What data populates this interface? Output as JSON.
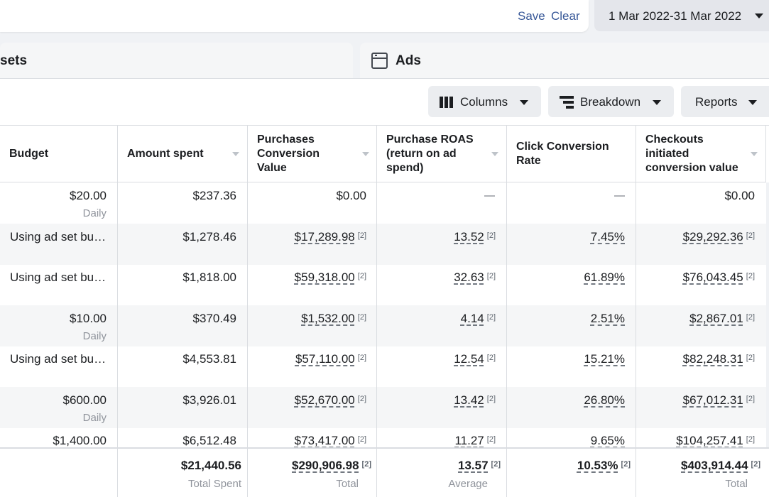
{
  "topbar": {
    "save_label": "Save",
    "clear_label": "Clear",
    "date_range": "1 Mar 2022-31 Mar 2022"
  },
  "tabs": {
    "adsets_label": "sets",
    "ads_label": "Ads"
  },
  "toolbar": {
    "columns_label": "Columns",
    "breakdown_label": "Breakdown",
    "reports_label": "Reports"
  },
  "table": {
    "headers": {
      "budget": "Budget",
      "amount_spent": "Amount spent",
      "purchases_value": [
        "Purchases",
        "Conversion",
        "Value"
      ],
      "roas": [
        "Purchase ROAS",
        "(return on ad",
        "spend)"
      ],
      "click_rate": [
        "Click Conversion",
        "Rate"
      ],
      "checkouts": [
        "Checkouts",
        "initiated",
        "conversion value"
      ]
    },
    "ref": "[2]",
    "rows": [
      {
        "budget": "$20.00",
        "budget_sub": "Daily",
        "spent": "$237.36",
        "purchases": "$0.00",
        "roas": "—",
        "click": "—",
        "checkouts": "$0.00"
      },
      {
        "budget": "Using ad set bu…",
        "budget_sub": "",
        "spent": "$1,278.46",
        "purchases": "$17,289.98",
        "roas": "13.52",
        "click": "7.45%",
        "checkouts": "$29,292.36"
      },
      {
        "budget": "Using ad set bu…",
        "budget_sub": "",
        "spent": "$1,818.00",
        "purchases": "$59,318.00",
        "roas": "32.63",
        "click": "61.89%",
        "checkouts": "$76,043.45"
      },
      {
        "budget": "$10.00",
        "budget_sub": "Daily",
        "spent": "$370.49",
        "purchases": "$1,532.00",
        "roas": "4.14",
        "click": "2.51%",
        "checkouts": "$2,867.01"
      },
      {
        "budget": "Using ad set bu…",
        "budget_sub": "",
        "spent": "$4,553.81",
        "purchases": "$57,110.00",
        "roas": "12.54",
        "click": "15.21%",
        "checkouts": "$82,248.31"
      },
      {
        "budget": "$600.00",
        "budget_sub": "Daily",
        "spent": "$3,926.01",
        "purchases": "$52,670.00",
        "roas": "13.42",
        "click": "26.80%",
        "checkouts": "$67,012.31"
      },
      {
        "budget": "$1,400.00",
        "budget_sub": "",
        "spent": "$6,512.48",
        "purchases": "$73,417.00",
        "roas": "11.27",
        "click": "9.65%",
        "checkouts": "$104,257.41"
      }
    ],
    "totals": {
      "spent": "$21,440.56",
      "spent_sub": "Total Spent",
      "purchases": "$290,906.98",
      "purchases_sub": "Total",
      "roas": "13.57",
      "roas_sub": "Average",
      "click": "10.53%",
      "checkouts": "$403,914.44",
      "checkouts_sub": "Total"
    }
  }
}
